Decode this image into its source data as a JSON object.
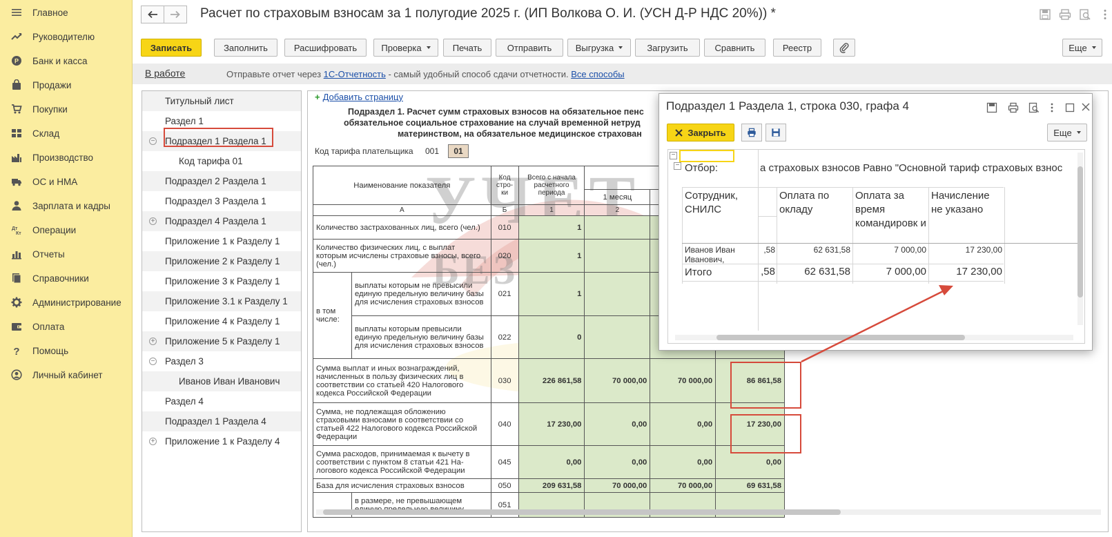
{
  "sidebar": {
    "items": [
      {
        "label": "Главное",
        "icon": "menu-icon"
      },
      {
        "label": "Руководителю",
        "icon": "trend-icon"
      },
      {
        "label": "Банк и касса",
        "icon": "coin-icon"
      },
      {
        "label": "Продажи",
        "icon": "bag-icon"
      },
      {
        "label": "Покупки",
        "icon": "cart-icon"
      },
      {
        "label": "Склад",
        "icon": "grid-icon"
      },
      {
        "label": "Производство",
        "icon": "factory-icon"
      },
      {
        "label": "ОС и НМА",
        "icon": "truck-icon"
      },
      {
        "label": "Зарплата и кадры",
        "icon": "person-icon"
      },
      {
        "label": "Операции",
        "icon": "dt-kt-icon"
      },
      {
        "label": "Отчеты",
        "icon": "chart-icon"
      },
      {
        "label": "Справочники",
        "icon": "book-icon"
      },
      {
        "label": "Администрирование",
        "icon": "gear-icon"
      },
      {
        "label": "Оплата",
        "icon": "wallet-icon"
      },
      {
        "label": "Помощь",
        "icon": "question-icon"
      },
      {
        "label": "Личный кабинет",
        "icon": "user-circle-icon"
      }
    ]
  },
  "header": {
    "title": "Расчет по страховым взносам за 1 полугодие 2025 г. (ИП Волкова О. И. (УСН Д-Р НДС 20%)) *"
  },
  "toolbar": {
    "save": "Записать",
    "fill": "Заполнить",
    "decode": "Расшифровать",
    "check": "Проверка",
    "print": "Печать",
    "send": "Отправить",
    "export": "Выгрузка",
    "load": "Загрузить",
    "compare": "Сравнить",
    "registry": "Реестр",
    "more": "Еще"
  },
  "info": {
    "status": "В работе",
    "text1": "Отправьте отчет через ",
    "link1": "1С-Отчетность",
    "text2": " - самый удобный способ сдачи отчетности. ",
    "link2": "Все способы"
  },
  "tree": {
    "items": [
      {
        "label": "Титульный лист",
        "level": 0,
        "toggle": ""
      },
      {
        "label": "Раздел 1",
        "level": 0,
        "toggle": ""
      },
      {
        "label": "Подраздел 1 Раздела 1",
        "level": 0,
        "toggle": "−"
      },
      {
        "label": "Код тарифа 01",
        "level": 1,
        "toggle": ""
      },
      {
        "label": "Подраздел 2 Раздела 1",
        "level": 0,
        "toggle": ""
      },
      {
        "label": "Подраздел 3 Раздела 1",
        "level": 0,
        "toggle": ""
      },
      {
        "label": "Подраздел 4 Раздела 1",
        "level": 0,
        "toggle": "+"
      },
      {
        "label": "Приложение 1 к Разделу 1",
        "level": 0,
        "toggle": ""
      },
      {
        "label": "Приложение 2 к Разделу 1",
        "level": 0,
        "toggle": ""
      },
      {
        "label": "Приложение 3 к Разделу 1",
        "level": 0,
        "toggle": ""
      },
      {
        "label": "Приложение 3.1 к Разделу 1",
        "level": 0,
        "toggle": ""
      },
      {
        "label": "Приложение 4 к Разделу 1",
        "level": 0,
        "toggle": ""
      },
      {
        "label": "Приложение 5 к Разделу 1",
        "level": 0,
        "toggle": "+"
      },
      {
        "label": "Раздел 3",
        "level": 0,
        "toggle": "−"
      },
      {
        "label": "Иванов Иван Иванович",
        "level": 1,
        "toggle": ""
      },
      {
        "label": "Раздел 4",
        "level": 0,
        "toggle": ""
      },
      {
        "label": "Подраздел 1 Раздела 4",
        "level": 0,
        "toggle": ""
      },
      {
        "label": "Приложение 1 к Разделу 4",
        "level": 0,
        "toggle": "+"
      }
    ]
  },
  "report": {
    "add_page": "Добавить страницу",
    "heading1": "Подраздел 1. Расчет сумм страховых взносов на обязательное пенс",
    "heading2": "обязательное социальное страхование на случай временной нетруд",
    "heading3": "материнством, на обязательное медицинское страхован",
    "tariff_label": "Код тарифа плательщика",
    "tariff_code": "001",
    "tariff_value": "01",
    "col_name": "Наименование показателя",
    "col_code": "Код стро- ки",
    "col_total": "Всего с начала расчетного периода",
    "col_incl": "в том ч рас",
    "col_m1": "1 месяц",
    "letter_a": "А",
    "letter_b": "Б",
    "n1": "1",
    "n2": "2",
    "in_that": "в том числе:",
    "rows": [
      {
        "name": "Количество застрахованных лиц, всего (чел.)",
        "code": "010",
        "v1": "1",
        "v2": "",
        "v3": "",
        "v4": ""
      },
      {
        "name": "Количество физических лиц, с выплат которым исчислены страховые взносы, всего (чел.)",
        "code": "020",
        "v1": "1",
        "v2": "",
        "v3": "",
        "v4": ""
      },
      {
        "name": "выплаты которым не превысили единую предельную величину базы для исчисления страховых взносов",
        "code": "021",
        "v1": "1",
        "v2": "",
        "v3": "",
        "v4": ""
      },
      {
        "name": "выплаты которым превысили единую предельную величину базы для исчисления страховых взносов",
        "code": "022",
        "v1": "0",
        "v2": "",
        "v3": "",
        "v4": ""
      },
      {
        "name": "Сумма выплат и иных вознаграждений, начисленных в пользу физических лиц в соответствии со статьей 420 Налогового кодекса Российской Федерации",
        "code": "030",
        "v1": "226 861,58",
        "v2": "70 000,00",
        "v3": "70 000,00",
        "v4": "86 861,58"
      },
      {
        "name": "Сумма, не подлежащая обложению страховыми взносами в соответствии со статьей 422 Налогового кодекса Российской Федерации",
        "code": "040",
        "v1": "17 230,00",
        "v2": "0,00",
        "v3": "0,00",
        "v4": "17 230,00"
      },
      {
        "name": "Сумма расходов, принимаемая к вычету в соответствии с пунктом 8 статьи 421 На- логового кодекса Российской Федерации",
        "code": "045",
        "v1": "0,00",
        "v2": "0,00",
        "v3": "0,00",
        "v4": "0,00"
      },
      {
        "name": "База для исчисления страховых взносов",
        "code": "050",
        "v1": "209 631,58",
        "v2": "70 000,00",
        "v3": "70 000,00",
        "v4": "69 631,58"
      },
      {
        "name": "в размере, не превышающем единую предельную величину",
        "code": "051",
        "v1": "",
        "v2": "",
        "v3": "",
        "v4": ""
      }
    ]
  },
  "popup": {
    "title": "Подраздел 1 Раздела 1, строка 030, графа 4",
    "close": "Закрыть",
    "more": "Еще",
    "filter_label": "Отбор:",
    "filter_value": "а страховых взносов Равно \"Основной тариф страховых взнос",
    "col_employee": "Сотрудник, СНИЛС",
    "col_salary": "Оплата по окладу",
    "col_trip": "Оплата за время командировк и",
    "col_unspecified": "Начисление не указано",
    "row_name": "Иванов Иван Иванович,",
    "row_partial": ",58",
    "row_salary": "62 631,58",
    "row_trip": "7 000,00",
    "row_unspecified": "17 230,00",
    "total_label": "Итого",
    "total_partial": ",58",
    "total_salary": "62 631,58",
    "total_trip": "7 000,00",
    "total_unspecified": "17 230,00"
  },
  "watermark": {
    "line1": "УЧЕТ",
    "line2": "БЕЗ ЗАБОТ"
  },
  "colors": {
    "sidebar": "#fbeda0",
    "primary_button": "#f7d516",
    "highlight": "#d64a3b",
    "green_cell": "#dbe9c9",
    "link": "#1b4fa8"
  }
}
